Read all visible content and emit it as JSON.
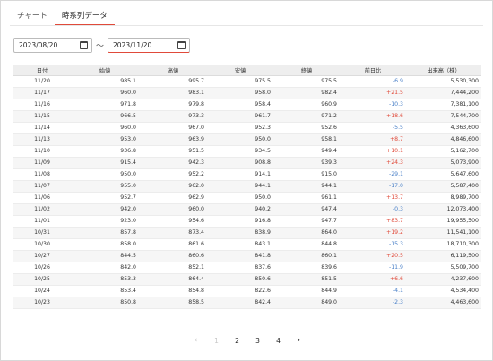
{
  "tabs": [
    {
      "label": "チャート"
    },
    {
      "label": "時系列データ"
    }
  ],
  "date_range": {
    "from": "2023/08/20",
    "separator": "〜",
    "to": "2023/11/20"
  },
  "table": {
    "headers": [
      "日付",
      "始値",
      "高値",
      "安値",
      "終値",
      "前日比",
      "出来高（株）"
    ],
    "rows": [
      {
        "date": "11/20",
        "open": "985.1",
        "high": "995.7",
        "low": "975.5",
        "close": "975.5",
        "change": "-6.9",
        "dir": "down",
        "volume": "5,530,300"
      },
      {
        "date": "11/17",
        "open": "960.0",
        "high": "983.1",
        "low": "958.0",
        "close": "982.4",
        "change": "+21.5",
        "dir": "up",
        "volume": "7,444,200"
      },
      {
        "date": "11/16",
        "open": "971.8",
        "high": "979.8",
        "low": "958.4",
        "close": "960.9",
        "change": "-10.3",
        "dir": "down",
        "volume": "7,381,100"
      },
      {
        "date": "11/15",
        "open": "966.5",
        "high": "973.3",
        "low": "961.7",
        "close": "971.2",
        "change": "+18.6",
        "dir": "up",
        "volume": "7,544,700"
      },
      {
        "date": "11/14",
        "open": "960.0",
        "high": "967.0",
        "low": "952.3",
        "close": "952.6",
        "change": "-5.5",
        "dir": "down",
        "volume": "4,363,600"
      },
      {
        "date": "11/13",
        "open": "953.0",
        "high": "963.9",
        "low": "950.0",
        "close": "958.1",
        "change": "+8.7",
        "dir": "up",
        "volume": "4,846,600"
      },
      {
        "date": "11/10",
        "open": "936.8",
        "high": "951.5",
        "low": "934.5",
        "close": "949.4",
        "change": "+10.1",
        "dir": "up",
        "volume": "5,162,700"
      },
      {
        "date": "11/09",
        "open": "915.4",
        "high": "942.3",
        "low": "908.8",
        "close": "939.3",
        "change": "+24.3",
        "dir": "up",
        "volume": "5,073,900"
      },
      {
        "date": "11/08",
        "open": "950.0",
        "high": "952.2",
        "low": "914.1",
        "close": "915.0",
        "change": "-29.1",
        "dir": "down",
        "volume": "5,647,600"
      },
      {
        "date": "11/07",
        "open": "955.0",
        "high": "962.0",
        "low": "944.1",
        "close": "944.1",
        "change": "-17.0",
        "dir": "down",
        "volume": "5,587,400"
      },
      {
        "date": "11/06",
        "open": "952.7",
        "high": "962.9",
        "low": "950.0",
        "close": "961.1",
        "change": "+13.7",
        "dir": "up",
        "volume": "8,989,700"
      },
      {
        "date": "11/02",
        "open": "942.0",
        "high": "960.0",
        "low": "940.2",
        "close": "947.4",
        "change": "-0.3",
        "dir": "down",
        "volume": "12,073,400"
      },
      {
        "date": "11/01",
        "open": "923.0",
        "high": "954.6",
        "low": "916.8",
        "close": "947.7",
        "change": "+83.7",
        "dir": "up",
        "volume": "19,955,500"
      },
      {
        "date": "10/31",
        "open": "857.8",
        "high": "873.4",
        "low": "838.9",
        "close": "864.0",
        "change": "+19.2",
        "dir": "up",
        "volume": "11,541,100"
      },
      {
        "date": "10/30",
        "open": "858.0",
        "high": "861.6",
        "low": "843.1",
        "close": "844.8",
        "change": "-15.3",
        "dir": "down",
        "volume": "18,710,300"
      },
      {
        "date": "10/27",
        "open": "844.5",
        "high": "860.6",
        "low": "841.8",
        "close": "860.1",
        "change": "+20.5",
        "dir": "up",
        "volume": "6,119,500"
      },
      {
        "date": "10/26",
        "open": "842.0",
        "high": "852.1",
        "low": "837.6",
        "close": "839.6",
        "change": "-11.9",
        "dir": "down",
        "volume": "5,509,700"
      },
      {
        "date": "10/25",
        "open": "853.3",
        "high": "864.4",
        "low": "850.6",
        "close": "851.5",
        "change": "+6.6",
        "dir": "up",
        "volume": "4,237,600"
      },
      {
        "date": "10/24",
        "open": "853.4",
        "high": "854.8",
        "low": "822.6",
        "close": "844.9",
        "change": "-4.1",
        "dir": "down",
        "volume": "4,534,400"
      },
      {
        "date": "10/23",
        "open": "850.8",
        "high": "858.5",
        "low": "842.4",
        "close": "849.0",
        "change": "-2.3",
        "dir": "down",
        "volume": "4,463,600"
      }
    ]
  },
  "pagination": {
    "prev_icon": "chevron-left-icon",
    "pages": [
      "1",
      "2",
      "3",
      "4"
    ],
    "current": "1",
    "next_icon": "chevron-right-icon"
  },
  "colors": {
    "accent": "#e04a3a",
    "up": "#e04a3a",
    "down": "#4a80c8",
    "header_bg": "#eeeeee"
  }
}
